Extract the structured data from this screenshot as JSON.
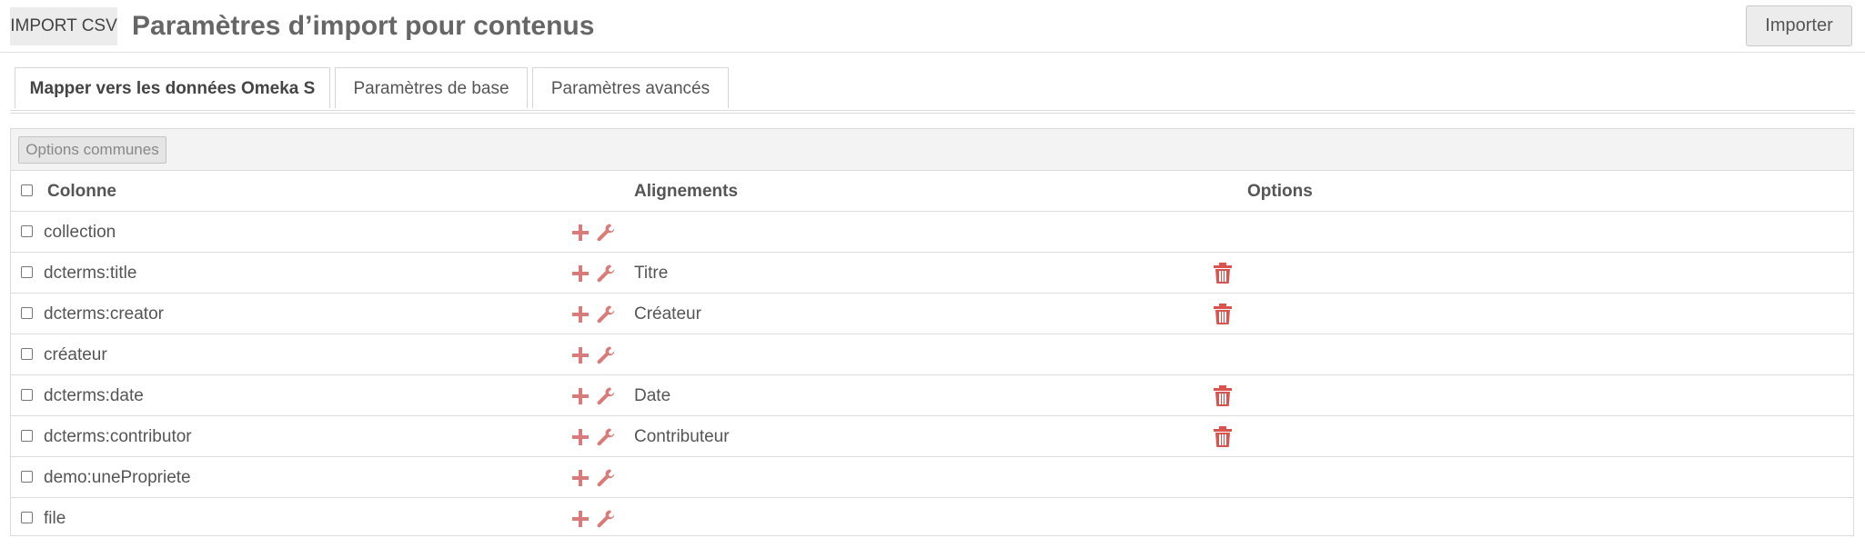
{
  "header": {
    "module_badge": "IMPORT CSV",
    "title": "Paramètres d’import pour contenus",
    "import_button": "Importer"
  },
  "tabs": [
    {
      "label": "Mapper vers les données Omeka S",
      "active": true
    },
    {
      "label": "Paramètres de base",
      "active": false
    },
    {
      "label": "Paramètres avancés",
      "active": false
    }
  ],
  "toolbar": {
    "common_options_button": "Options communes"
  },
  "table": {
    "columns": {
      "column": "Colonne",
      "mappings": "Alignements",
      "options": "Options"
    },
    "rows": [
      {
        "name": "collection",
        "mapping": "",
        "has_delete": false
      },
      {
        "name": "dcterms:title",
        "mapping": "Titre",
        "has_delete": true
      },
      {
        "name": "dcterms:creator",
        "mapping": "Créateur",
        "has_delete": true
      },
      {
        "name": "créateur",
        "mapping": "",
        "has_delete": false
      },
      {
        "name": "dcterms:date",
        "mapping": "Date",
        "has_delete": true
      },
      {
        "name": "dcterms:contributor",
        "mapping": "Contributeur",
        "has_delete": true
      },
      {
        "name": "demo:unePropriete",
        "mapping": "",
        "has_delete": false
      },
      {
        "name": "file",
        "mapping": "",
        "has_delete": false
      }
    ]
  },
  "icons": {
    "add": "plus-icon",
    "configure": "wrench-icon",
    "remove": "trash-icon"
  },
  "colors": {
    "accent_red": "#d9534f",
    "icon_red": "#d97b78",
    "badge_bg": "#ececec",
    "toolbar_bg": "#f3f3f3"
  }
}
